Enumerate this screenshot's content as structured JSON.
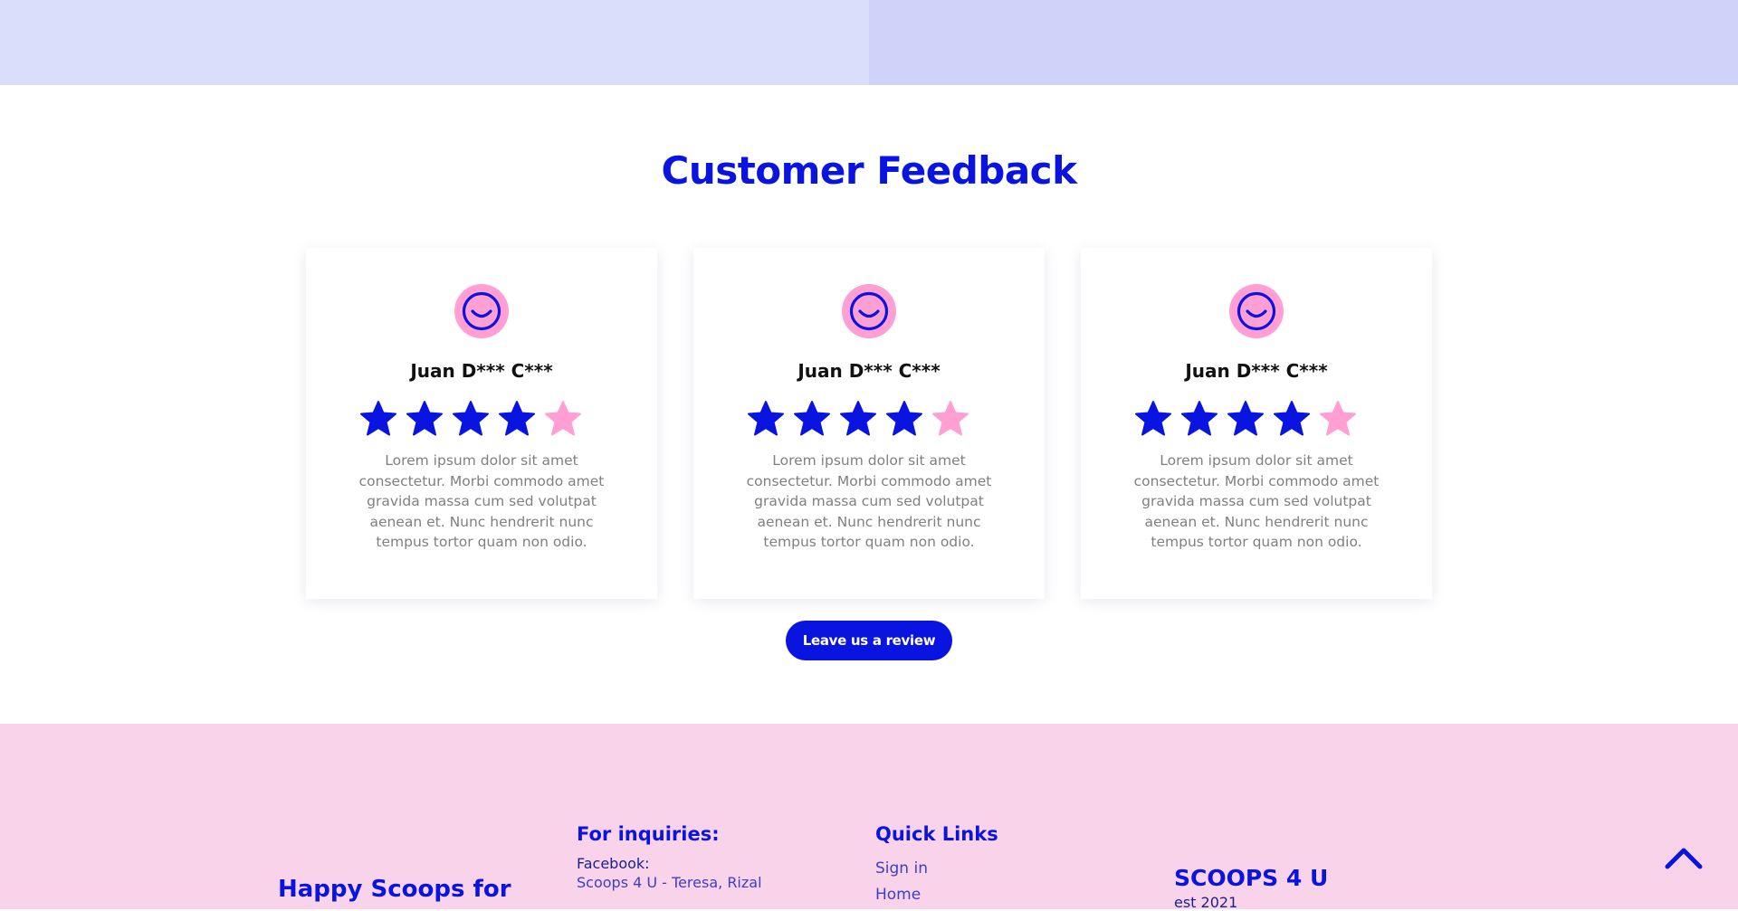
{
  "section": {
    "title": "Customer Feedback"
  },
  "reviews": [
    {
      "name": "Juan D*** C***",
      "rating": 4,
      "max_rating": 5,
      "text": "Lorem ipsum dolor sit amet consectetur. Morbi commodo amet gravida massa cum sed volutpat aenean et. Nunc hendrerit nunc tempus tortor quam non odio."
    },
    {
      "name": "Juan D*** C***",
      "rating": 4,
      "max_rating": 5,
      "text": "Lorem ipsum dolor sit amet consectetur. Morbi commodo amet gravida massa cum sed volutpat aenean et. Nunc hendrerit nunc tempus tortor quam non odio."
    },
    {
      "name": "Juan D*** C***",
      "rating": 4,
      "max_rating": 5,
      "text": "Lorem ipsum dolor sit amet consectetur. Morbi commodo amet gravida massa cum sed volutpat aenean et. Nunc hendrerit nunc tempus tortor quam non odio."
    }
  ],
  "review_button": {
    "label": "Leave us a review"
  },
  "footer": {
    "tagline": "Happy Scoops for",
    "inquiries": {
      "heading": "For inquiries:",
      "facebook_label": "Facebook:",
      "facebook_value": "Scoops 4 U - Teresa, Rizal"
    },
    "quick_links": {
      "heading": "Quick Links",
      "items": [
        "Sign in",
        "Home"
      ]
    },
    "brand": {
      "name": "SCOOPS 4 U",
      "est": "est 2021"
    }
  },
  "icons": {
    "avatar": "smiley-face-icon",
    "star": "star-icon",
    "back_to_top": "chevron-up-icon"
  },
  "colors": {
    "brand_blue": "#0a14e0",
    "pink": "#ff9fd4",
    "footer_pink": "#f9d3ea",
    "header_lavender": "#dbdefb"
  }
}
